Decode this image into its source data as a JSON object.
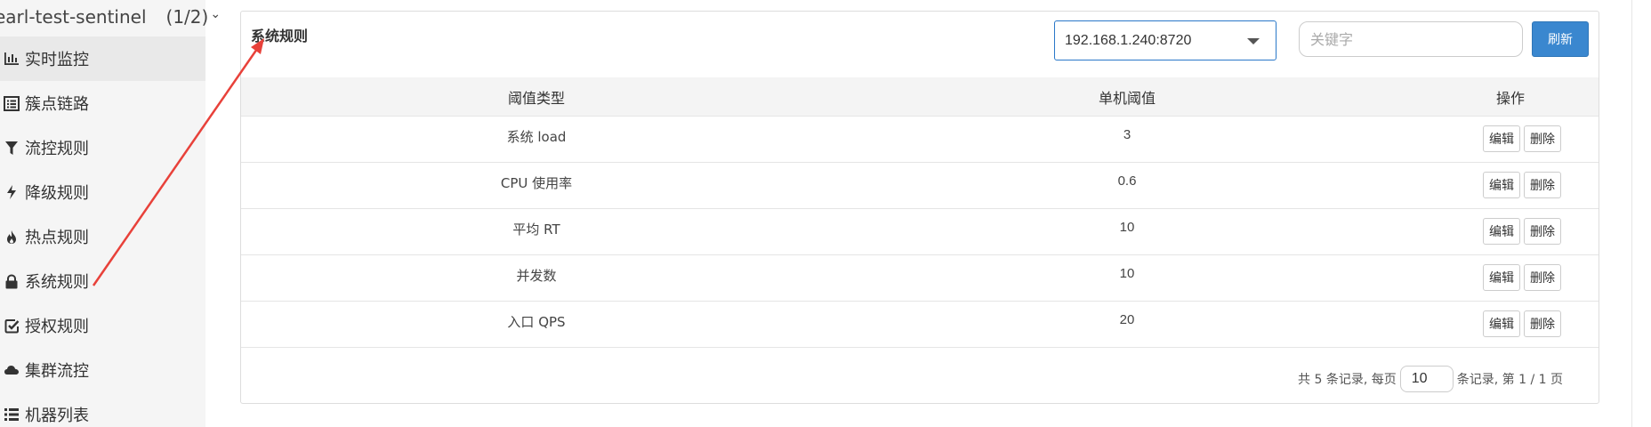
{
  "app": {
    "name": "earl-test-sentinel",
    "count": "(1/2)"
  },
  "sidebar": {
    "items": [
      {
        "label": "实时监控",
        "icon": "bar-chart-icon"
      },
      {
        "label": "簇点链路",
        "icon": "list-alt-icon"
      },
      {
        "label": "流控规则",
        "icon": "filter-icon"
      },
      {
        "label": "降级规则",
        "icon": "flash-icon"
      },
      {
        "label": "热点规则",
        "icon": "fire-icon"
      },
      {
        "label": "系统规则",
        "icon": "lock-icon"
      },
      {
        "label": "授权规则",
        "icon": "check-square-icon"
      },
      {
        "label": "集群流控",
        "icon": "cloud-icon"
      },
      {
        "label": "机器列表",
        "icon": "list-icon"
      }
    ]
  },
  "panel": {
    "title": "系统规则",
    "host_select": "192.168.1.240:8720",
    "search_placeholder": "关键字",
    "refresh_label": "刷新"
  },
  "table": {
    "headers": [
      "阈值类型",
      "单机阈值",
      "操作"
    ],
    "rows": [
      {
        "type": "系统 load",
        "threshold": "3"
      },
      {
        "type": "CPU 使用率",
        "threshold": "0.6"
      },
      {
        "type": "平均 RT",
        "threshold": "10"
      },
      {
        "type": "并发数",
        "threshold": "10"
      },
      {
        "type": "入口 QPS",
        "threshold": "20"
      }
    ],
    "edit_label": "编辑",
    "delete_label": "删除"
  },
  "pager": {
    "prefix": "共 5 条记录, 每页",
    "page_size": "10",
    "suffix": "条记录, 第 1 / 1 页"
  },
  "annotation": {
    "arrow_color": "#e8413a"
  }
}
